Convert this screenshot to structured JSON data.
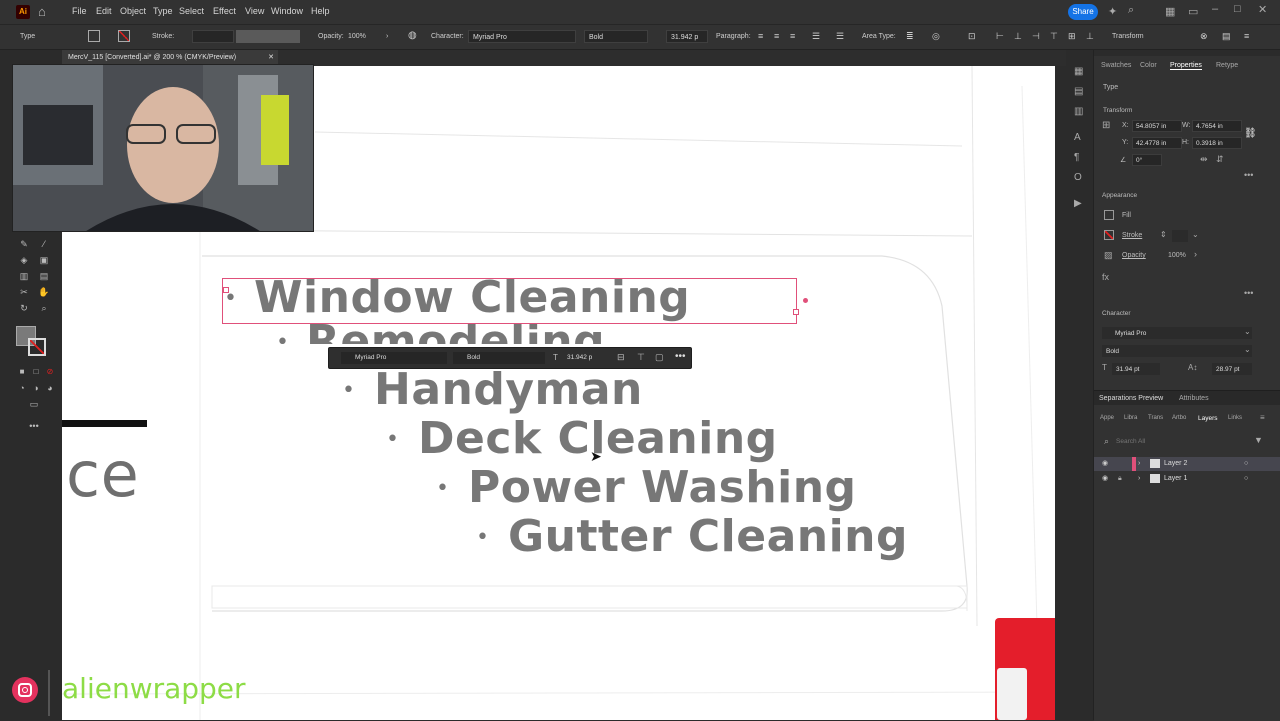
{
  "menubar": {
    "logo": "Ai",
    "items": [
      "File",
      "Edit",
      "Object",
      "Type",
      "Select",
      "Effect",
      "View",
      "Window",
      "Help"
    ],
    "share": "Share"
  },
  "control_bar": {
    "mode": "Type",
    "stroke_label": "Stroke:",
    "opacity_label": "Opacity:",
    "opacity_value": "100%",
    "character_label": "Character:",
    "font_family": "Myriad Pro",
    "font_style": "Bold",
    "font_size": "31.942 p",
    "paragraph_label": "Paragraph:",
    "area_type_label": "Area Type:",
    "transform_label": "Transform"
  },
  "document_tab": {
    "title": "MercV_115 [Converted].ai* @ 200 % (CMYK/Preview)"
  },
  "canvas": {
    "services": [
      "Window Cleaning",
      "Remodeling",
      "Handyman",
      "Deck Cleaning",
      "Power Washing",
      "Gutter Cleaning"
    ],
    "bullet": "•",
    "partial_text": "ce"
  },
  "context_bar": {
    "font_family": "Myriad Pro",
    "font_style": "Bold",
    "font_size": "31.942 p"
  },
  "properties_panel": {
    "tabs": [
      "Swatches",
      "Color",
      "Properties",
      "Retype"
    ],
    "active_tab": "Properties",
    "type_label": "Type",
    "transform_label": "Transform",
    "x": "54.8057 in",
    "y": "42.4778 in",
    "w": "4.7654 in",
    "h": "0.3918 in",
    "angle": "0°",
    "appearance_label": "Appearance",
    "fill_label": "Fill",
    "stroke_label": "Stroke",
    "opacity_label": "Opacity",
    "opacity_value": "100%",
    "character_label": "Character",
    "font_family": "Myriad Pro",
    "font_style": "Bold",
    "font_size": "31.94 pt",
    "leading": "28.97 pt"
  },
  "layers_panel": {
    "top_tabs": [
      "Separations Preview",
      "Attributes"
    ],
    "tabs": [
      "Appe",
      "Libra",
      "Trans",
      "Artbo",
      "Layers",
      "Links"
    ],
    "active_tab": "Layers",
    "search_placeholder": "Search All",
    "layers": [
      "Layer 2",
      "Layer 1"
    ]
  },
  "social": {
    "handle": "alienwrapper"
  },
  "colors": {
    "accent": "#1473e6",
    "selection": "#e0507a",
    "text_gray": "#777777"
  }
}
